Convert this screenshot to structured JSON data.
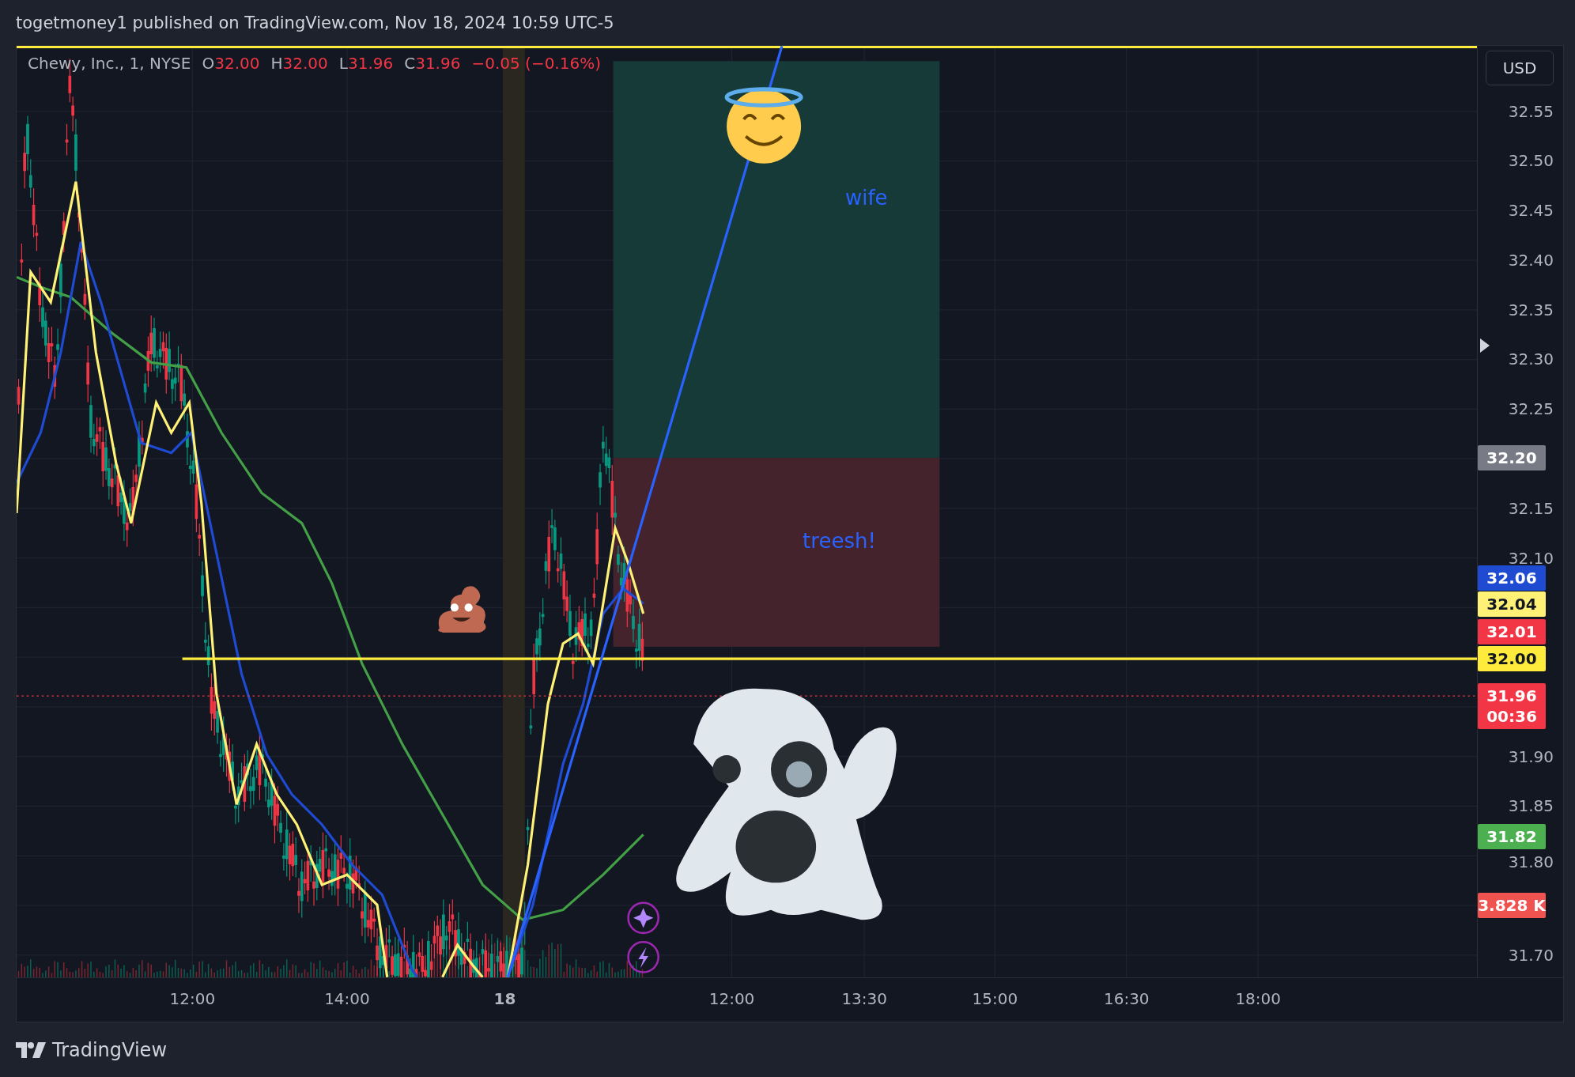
{
  "header": {
    "title": "togetmoney1 published on TradingView.com, Nov 18, 2024 10:59 UTC-5"
  },
  "legend": {
    "symbol": "Chewy, Inc., 1, NYSE",
    "values": [
      {
        "label": "O",
        "value": "32.00"
      },
      {
        "label": "H",
        "value": "32.00"
      },
      {
        "label": "L",
        "value": "31.96"
      },
      {
        "label": "C",
        "value": "31.96"
      }
    ],
    "change": "−0.05 (−0.16%)"
  },
  "annotations": [
    {
      "text": "wife"
    },
    {
      "text": "treesh!"
    }
  ],
  "price_axis": {
    "currency_button": "USD",
    "ticks": [
      "32.55",
      "32.50",
      "32.45",
      "32.40",
      "32.35",
      "32.30",
      "32.25",
      "32.15",
      "32.10",
      "31.90",
      "31.85",
      "31.80",
      "31.70"
    ],
    "badges": [
      {
        "text": "32.20",
        "color": "#787b86"
      },
      {
        "text": "32.06",
        "color": "#1e4bd2"
      },
      {
        "text": "32.04",
        "color": "#fff176"
      },
      {
        "text": "32.01",
        "color": "#f23645"
      },
      {
        "text": "32.00",
        "color": "#ffeb3b"
      },
      {
        "text": "31.96",
        "subtext": "00:36",
        "color": "#f23645"
      },
      {
        "text": "31.82",
        "color": "#4caf50"
      },
      {
        "text": "3.828 K",
        "color": "#ef5350"
      }
    ]
  },
  "time_axis": [
    {
      "text": "12:00",
      "kind": "time"
    },
    {
      "text": "14:00",
      "kind": "time"
    },
    {
      "text": "18",
      "kind": "date"
    },
    {
      "text": "12:00",
      "kind": "time"
    },
    {
      "text": "13:30",
      "kind": "time"
    },
    {
      "text": "15:00",
      "kind": "time"
    },
    {
      "text": "16:30",
      "kind": "time"
    },
    {
      "text": "18:00",
      "kind": "time"
    }
  ],
  "footer": {
    "brand": "TradingView"
  }
}
